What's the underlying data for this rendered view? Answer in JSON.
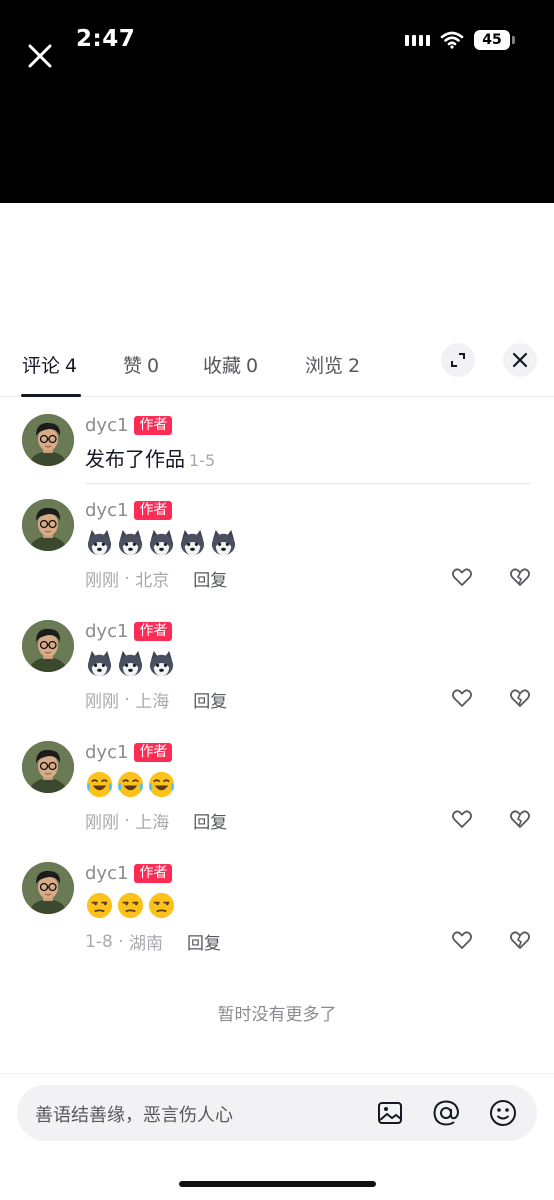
{
  "status_bar": {
    "time": "2:47",
    "battery": "45"
  },
  "tabs": [
    {
      "label": "评论",
      "count": "4"
    },
    {
      "label": "赞",
      "count": "0"
    },
    {
      "label": "收藏",
      "count": "0"
    },
    {
      "label": "浏览",
      "count": "2"
    }
  ],
  "post": {
    "username": "dyc1",
    "badge": "作者",
    "text": "发布了作品",
    "date": "1-5"
  },
  "comments": [
    {
      "username": "dyc1",
      "badge": "作者",
      "emoji": "husky",
      "emoji_count": 5,
      "time": "刚刚",
      "location": "北京",
      "reply": "回复"
    },
    {
      "username": "dyc1",
      "badge": "作者",
      "emoji": "husky",
      "emoji_count": 3,
      "time": "刚刚",
      "location": "上海",
      "reply": "回复"
    },
    {
      "username": "dyc1",
      "badge": "作者",
      "emoji": "rofl",
      "emoji_count": 3,
      "time": "刚刚",
      "location": "上海",
      "reply": "回复"
    },
    {
      "username": "dyc1",
      "badge": "作者",
      "emoji": "unamused",
      "emoji_count": 3,
      "time": "1-8",
      "location": "湖南",
      "reply": "回复"
    }
  ],
  "footer_note": "暂时没有更多了",
  "input": {
    "placeholder": "善语结善缘，恶言伤人心"
  },
  "icons": [
    "close-icon",
    "expand-icon",
    "close-panel-icon",
    "heart-icon",
    "broken-heart-icon",
    "image-icon",
    "at-icon",
    "emoji-icon"
  ],
  "colors": {
    "badge": "#fe2c55",
    "text": "#161823",
    "muted": "#a8a9ad"
  }
}
